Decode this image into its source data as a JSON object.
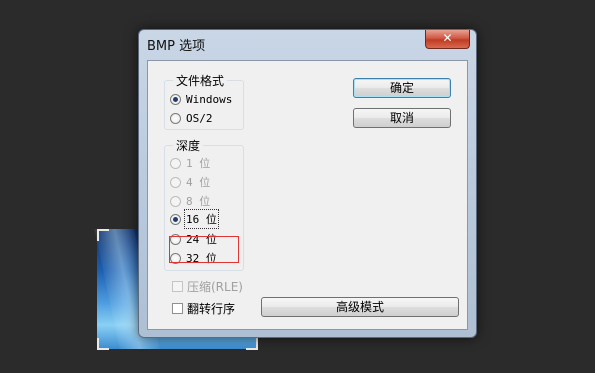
{
  "window": {
    "title": "BMP 选项",
    "close_glyph": "✕"
  },
  "file_format": {
    "label": "文件格式",
    "options": [
      {
        "label": "Windows",
        "checked": true
      },
      {
        "label": "OS/2",
        "checked": false
      }
    ]
  },
  "depth": {
    "label": "深度",
    "options": [
      {
        "label": "1 位",
        "enabled": false
      },
      {
        "label": "4 位",
        "enabled": false
      },
      {
        "label": "8 位",
        "enabled": false
      },
      {
        "label": "16 位",
        "enabled": true,
        "checked": true
      },
      {
        "label": "24 位",
        "enabled": true
      },
      {
        "label": "32 位",
        "enabled": true
      }
    ]
  },
  "options": {
    "compress_label": "压缩(RLE)",
    "flip_label": "翻转行序"
  },
  "buttons": {
    "ok": "确定",
    "cancel": "取消",
    "advanced": "高级模式"
  },
  "colors": {
    "highlight": "#e03535",
    "accent": "#3c7fb1"
  }
}
